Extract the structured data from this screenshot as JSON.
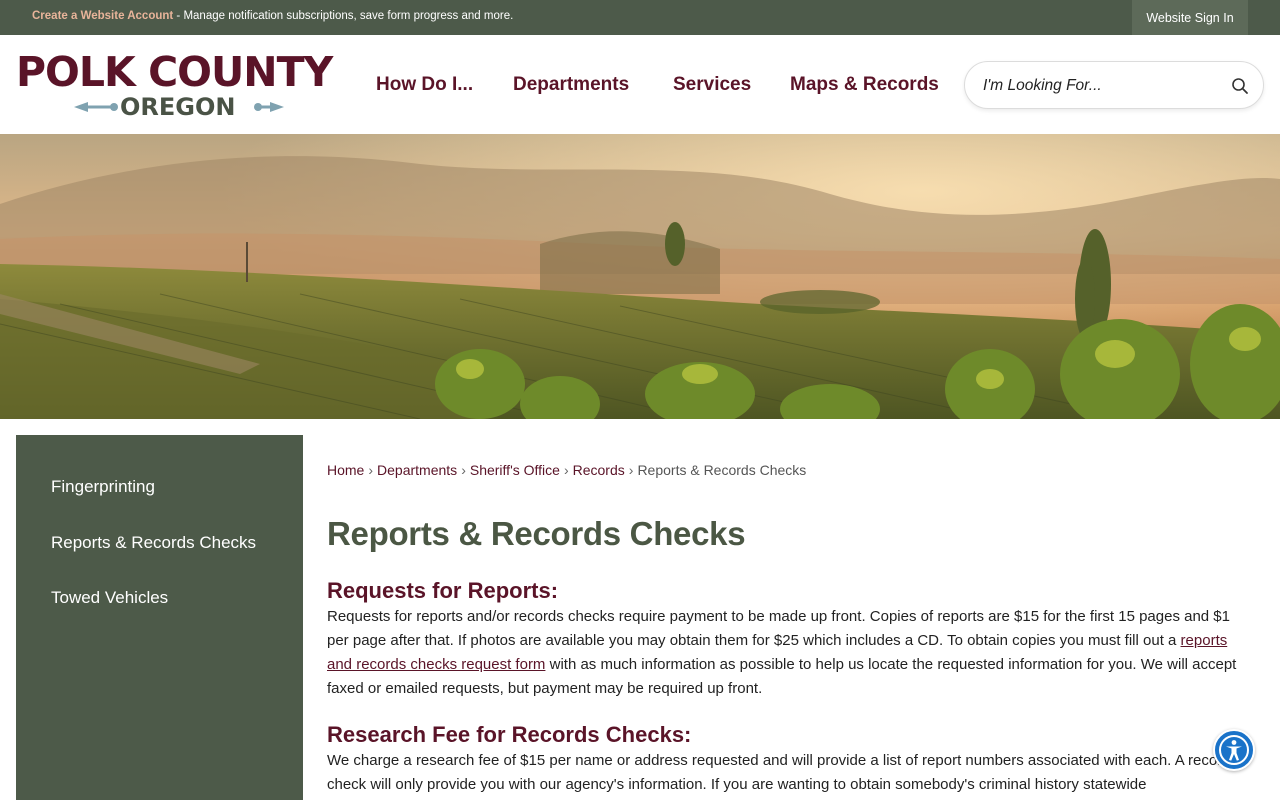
{
  "topbar": {
    "create_account_link": "Create a Website Account",
    "create_account_desc": " - Manage notification subscriptions, save form progress and more.",
    "sign_in": "Website Sign In"
  },
  "logo": {
    "line1": "POLK COUNTY",
    "line2": "OREGON"
  },
  "nav": {
    "items": [
      "How Do I...",
      "Departments",
      "Services",
      "Maps & Records"
    ]
  },
  "search": {
    "placeholder": "I'm Looking For..."
  },
  "sidebar": {
    "items": [
      "Fingerprinting",
      "Reports & Records Checks",
      "Towed Vehicles"
    ]
  },
  "breadcrumb": {
    "items": [
      "Home",
      "Departments",
      "Sheriff's Office",
      "Records"
    ],
    "current": "Reports & Records Checks",
    "separator": "›"
  },
  "page": {
    "title": "Reports & Records Checks",
    "sections": [
      {
        "heading": "Requests for Reports:",
        "text_before_link": "Requests for reports and/or records checks require payment to be made up front. Copies of reports are $15 for the first 15 pages and $1 per page after that. If photos are available you may obtain them for $25 which includes a CD. To obtain copies you must fill out a ",
        "link": "reports and records checks request form",
        "text_after_link": " with as much information as possible to help us locate the requested information for you. We will accept faxed or emailed requests, but payment may be required up front."
      },
      {
        "heading": "Research Fee for Records Checks:",
        "text": "We charge a research fee of $15 per name or address requested and will provide a list of report numbers associated with each. A records check will only provide you with our agency's information. If you are wanting to obtain somebody's criminal history statewide"
      }
    ]
  },
  "colors": {
    "topbar": "#4d5a4a",
    "brand_maroon": "#5a1428",
    "sidebar": "#4d5a49",
    "title_green": "#4b5744",
    "accessibility_blue": "#1a73c9"
  },
  "icons": {
    "search": "search-icon",
    "accessibility": "accessibility-icon"
  }
}
